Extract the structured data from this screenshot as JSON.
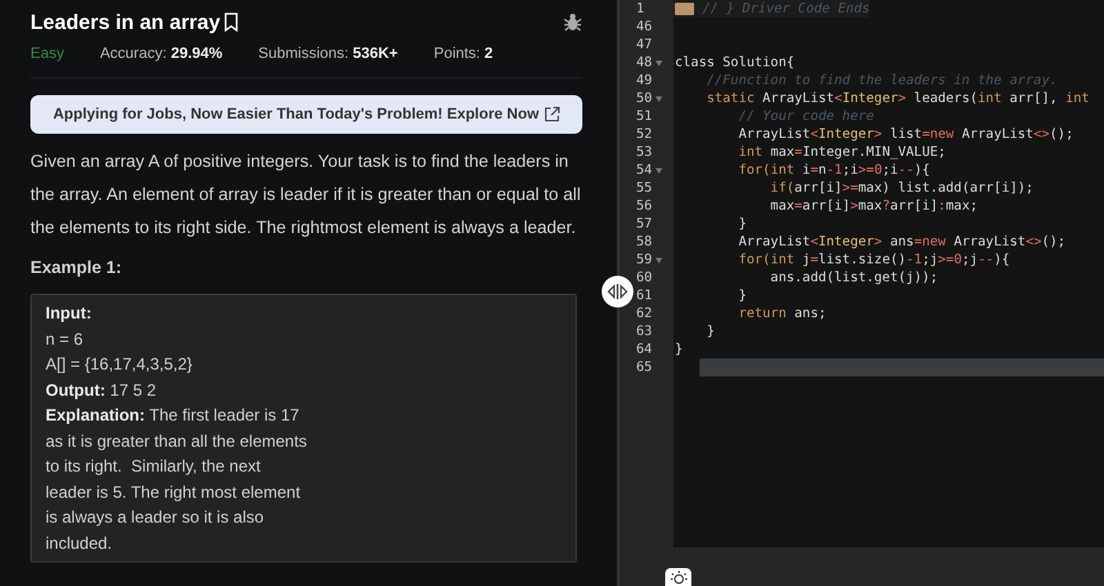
{
  "problem": {
    "title": "Leaders in an array",
    "difficulty": "Easy",
    "stats": [
      {
        "label": "Accuracy:",
        "value": "29.94%"
      },
      {
        "label": "Submissions:",
        "value": "536K+"
      },
      {
        "label": "Points:",
        "value": "2"
      }
    ],
    "banner": "Applying for Jobs, Now Easier Than Today's Problem! Explore Now",
    "description": "Given an array A of positive integers. Your task is to find the leaders in the array. An element of array is leader if it is greater than or equal to all the elements to its right side. The rightmost element is always a leader.",
    "example_heading": "Example 1:",
    "example_lines": [
      "**Input:**",
      "n = 6",
      "A[] = {16,17,4,3,5,2}",
      "**Output:** 17 5 2",
      "**Explanation:** The first leader is 17",
      "as it is greater than all the elements",
      "to its right.  Similarly, the next",
      "leader is 5. The right most element",
      "is always a leader so it is also",
      "included."
    ]
  },
  "editor": {
    "lines": [
      {
        "number": "1",
        "foldable": false,
        "folded": true,
        "current": false,
        "tokens": [
          {
            "text": "// } Driver Code Ends",
            "kind": "comment"
          }
        ]
      },
      {
        "number": "46",
        "foldable": false,
        "folded": false,
        "current": false
      },
      {
        "number": "47",
        "foldable": false,
        "folded": false,
        "current": false
      },
      {
        "number": "48",
        "foldable": true,
        "folded": false,
        "current": false,
        "tokens": [
          {
            "text": "class Solution{",
            "kind": "plain"
          }
        ]
      },
      {
        "number": "49",
        "foldable": false,
        "folded": false,
        "current": false,
        "tokens": [
          {
            "text": "    //Function to find the leaders in the array.",
            "kind": "comment"
          }
        ]
      },
      {
        "number": "50",
        "foldable": true,
        "folded": false,
        "current": false,
        "tokens": [
          {
            "text": "    static",
            "kind": "keyword"
          },
          {
            "text": " ArrayList",
            "kind": "plain"
          },
          {
            "text": "<",
            "kind": "operator"
          },
          {
            "text": "Integer",
            "kind": "type"
          },
          {
            "text": ">",
            "kind": "operator"
          },
          {
            "text": " leaders(",
            "kind": "plain"
          },
          {
            "text": "int",
            "kind": "keyword"
          },
          {
            "text": " arr[], ",
            "kind": "plain"
          },
          {
            "text": "int",
            "kind": "keyword"
          }
        ]
      },
      {
        "number": "51",
        "foldable": false,
        "folded": false,
        "current": false,
        "tokens": [
          {
            "text": "        // Your code here",
            "kind": "comment"
          }
        ]
      },
      {
        "number": "52",
        "foldable": false,
        "folded": false,
        "current": false,
        "tokens": [
          {
            "text": "        ArrayList",
            "kind": "plain"
          },
          {
            "text": "<",
            "kind": "operator"
          },
          {
            "text": "Integer",
            "kind": "type"
          },
          {
            "text": ">",
            "kind": "operator"
          },
          {
            "text": " list",
            "kind": "plain"
          },
          {
            "text": "=",
            "kind": "operator"
          },
          {
            "text": "new",
            "kind": "operator"
          },
          {
            "text": " ArrayList",
            "kind": "plain"
          },
          {
            "text": "<>",
            "kind": "operator"
          },
          {
            "text": "();",
            "kind": "plain"
          }
        ]
      },
      {
        "number": "53",
        "foldable": false,
        "folded": false,
        "current": false,
        "tokens": [
          {
            "text": "        int",
            "kind": "keyword"
          },
          {
            "text": " max",
            "kind": "plain"
          },
          {
            "text": "=",
            "kind": "operator"
          },
          {
            "text": "Integer.MIN_VALUE;",
            "kind": "plain"
          }
        ]
      },
      {
        "number": "54",
        "foldable": true,
        "folded": false,
        "current": false,
        "tokens": [
          {
            "text": "        for(",
            "kind": "keyword"
          },
          {
            "text": "int",
            "kind": "keyword"
          },
          {
            "text": " i",
            "kind": "plain"
          },
          {
            "text": "=",
            "kind": "operator"
          },
          {
            "text": "n",
            "kind": "plain"
          },
          {
            "text": "-1",
            "kind": "number"
          },
          {
            "text": ";i",
            "kind": "plain"
          },
          {
            "text": ">=",
            "kind": "operator"
          },
          {
            "text": "0",
            "kind": "number"
          },
          {
            "text": ";i",
            "kind": "plain"
          },
          {
            "text": "--",
            "kind": "operator"
          },
          {
            "text": "){",
            "kind": "plain"
          }
        ]
      },
      {
        "number": "55",
        "foldable": false,
        "folded": false,
        "current": false,
        "tokens": [
          {
            "text": "            if(",
            "kind": "keyword"
          },
          {
            "text": "arr[i]",
            "kind": "plain"
          },
          {
            "text": ">=",
            "kind": "operator"
          },
          {
            "text": "max) list.add(arr[i]);",
            "kind": "plain"
          }
        ]
      },
      {
        "number": "56",
        "foldable": false,
        "folded": false,
        "current": false,
        "tokens": [
          {
            "text": "            max",
            "kind": "plain"
          },
          {
            "text": "=",
            "kind": "operator"
          },
          {
            "text": "arr[i]",
            "kind": "plain"
          },
          {
            "text": ">",
            "kind": "operator"
          },
          {
            "text": "max",
            "kind": "plain"
          },
          {
            "text": "?",
            "kind": "operator"
          },
          {
            "text": "arr[i]",
            "kind": "plain"
          },
          {
            "text": ":",
            "kind": "operator"
          },
          {
            "text": "max;",
            "kind": "plain"
          }
        ]
      },
      {
        "number": "57",
        "foldable": false,
        "folded": false,
        "current": false,
        "tokens": [
          {
            "text": "        }",
            "kind": "plain"
          }
        ]
      },
      {
        "number": "58",
        "foldable": false,
        "folded": false,
        "current": false,
        "tokens": [
          {
            "text": "        ArrayList",
            "kind": "plain"
          },
          {
            "text": "<",
            "kind": "operator"
          },
          {
            "text": "Integer",
            "kind": "type"
          },
          {
            "text": ">",
            "kind": "operator"
          },
          {
            "text": " ans",
            "kind": "plain"
          },
          {
            "text": "=",
            "kind": "operator"
          },
          {
            "text": "new",
            "kind": "operator"
          },
          {
            "text": " ArrayList",
            "kind": "plain"
          },
          {
            "text": "<>",
            "kind": "operator"
          },
          {
            "text": "();",
            "kind": "plain"
          }
        ]
      },
      {
        "number": "59",
        "foldable": true,
        "folded": false,
        "current": false,
        "tokens": [
          {
            "text": "        for(",
            "kind": "keyword"
          },
          {
            "text": "int",
            "kind": "keyword"
          },
          {
            "text": " j",
            "kind": "plain"
          },
          {
            "text": "=",
            "kind": "operator"
          },
          {
            "text": "list.size()",
            "kind": "plain"
          },
          {
            "text": "-1",
            "kind": "number"
          },
          {
            "text": ";j",
            "kind": "plain"
          },
          {
            "text": ">=",
            "kind": "operator"
          },
          {
            "text": "0",
            "kind": "number"
          },
          {
            "text": ";j",
            "kind": "plain"
          },
          {
            "text": "--",
            "kind": "operator"
          },
          {
            "text": "){",
            "kind": "plain"
          }
        ]
      },
      {
        "number": "60",
        "foldable": false,
        "folded": false,
        "current": false,
        "tokens": [
          {
            "text": "            ans.add(list.get(j));",
            "kind": "plain"
          }
        ]
      },
      {
        "number": "61",
        "foldable": false,
        "folded": false,
        "current": false,
        "tokens": [
          {
            "text": "        }",
            "kind": "plain"
          }
        ]
      },
      {
        "number": "62",
        "foldable": false,
        "folded": false,
        "current": false,
        "tokens": [
          {
            "text": "        return",
            "kind": "keyword"
          },
          {
            "text": " ans;",
            "kind": "plain"
          }
        ]
      },
      {
        "number": "63",
        "foldable": false,
        "folded": false,
        "current": false,
        "tokens": [
          {
            "text": "    }",
            "kind": "plain"
          }
        ]
      },
      {
        "number": "64",
        "foldable": false,
        "folded": false,
        "current": false,
        "tokens": [
          {
            "text": "}",
            "kind": "plain"
          }
        ]
      },
      {
        "number": "65",
        "foldable": false,
        "folded": false,
        "current": true
      }
    ]
  }
}
